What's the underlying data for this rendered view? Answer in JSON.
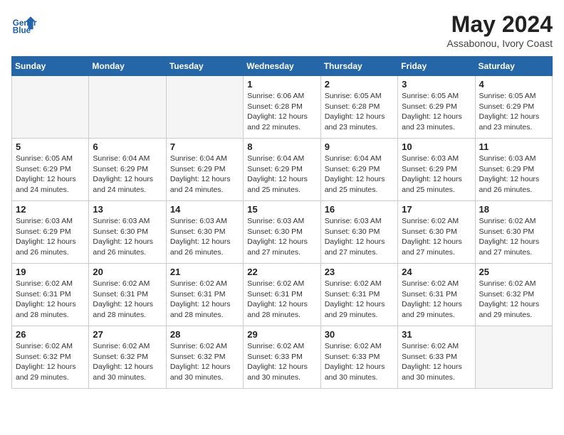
{
  "header": {
    "logo_line1": "General",
    "logo_line2": "Blue",
    "month_year": "May 2024",
    "location": "Assabonou, Ivory Coast"
  },
  "weekdays": [
    "Sunday",
    "Monday",
    "Tuesday",
    "Wednesday",
    "Thursday",
    "Friday",
    "Saturday"
  ],
  "weeks": [
    [
      {
        "day": "",
        "info": ""
      },
      {
        "day": "",
        "info": ""
      },
      {
        "day": "",
        "info": ""
      },
      {
        "day": "1",
        "info": "Sunrise: 6:06 AM\nSunset: 6:28 PM\nDaylight: 12 hours\nand 22 minutes."
      },
      {
        "day": "2",
        "info": "Sunrise: 6:05 AM\nSunset: 6:28 PM\nDaylight: 12 hours\nand 23 minutes."
      },
      {
        "day": "3",
        "info": "Sunrise: 6:05 AM\nSunset: 6:29 PM\nDaylight: 12 hours\nand 23 minutes."
      },
      {
        "day": "4",
        "info": "Sunrise: 6:05 AM\nSunset: 6:29 PM\nDaylight: 12 hours\nand 23 minutes."
      }
    ],
    [
      {
        "day": "5",
        "info": "Sunrise: 6:05 AM\nSunset: 6:29 PM\nDaylight: 12 hours\nand 24 minutes."
      },
      {
        "day": "6",
        "info": "Sunrise: 6:04 AM\nSunset: 6:29 PM\nDaylight: 12 hours\nand 24 minutes."
      },
      {
        "day": "7",
        "info": "Sunrise: 6:04 AM\nSunset: 6:29 PM\nDaylight: 12 hours\nand 24 minutes."
      },
      {
        "day": "8",
        "info": "Sunrise: 6:04 AM\nSunset: 6:29 PM\nDaylight: 12 hours\nand 25 minutes."
      },
      {
        "day": "9",
        "info": "Sunrise: 6:04 AM\nSunset: 6:29 PM\nDaylight: 12 hours\nand 25 minutes."
      },
      {
        "day": "10",
        "info": "Sunrise: 6:03 AM\nSunset: 6:29 PM\nDaylight: 12 hours\nand 25 minutes."
      },
      {
        "day": "11",
        "info": "Sunrise: 6:03 AM\nSunset: 6:29 PM\nDaylight: 12 hours\nand 26 minutes."
      }
    ],
    [
      {
        "day": "12",
        "info": "Sunrise: 6:03 AM\nSunset: 6:29 PM\nDaylight: 12 hours\nand 26 minutes."
      },
      {
        "day": "13",
        "info": "Sunrise: 6:03 AM\nSunset: 6:30 PM\nDaylight: 12 hours\nand 26 minutes."
      },
      {
        "day": "14",
        "info": "Sunrise: 6:03 AM\nSunset: 6:30 PM\nDaylight: 12 hours\nand 26 minutes."
      },
      {
        "day": "15",
        "info": "Sunrise: 6:03 AM\nSunset: 6:30 PM\nDaylight: 12 hours\nand 27 minutes."
      },
      {
        "day": "16",
        "info": "Sunrise: 6:03 AM\nSunset: 6:30 PM\nDaylight: 12 hours\nand 27 minutes."
      },
      {
        "day": "17",
        "info": "Sunrise: 6:02 AM\nSunset: 6:30 PM\nDaylight: 12 hours\nand 27 minutes."
      },
      {
        "day": "18",
        "info": "Sunrise: 6:02 AM\nSunset: 6:30 PM\nDaylight: 12 hours\nand 27 minutes."
      }
    ],
    [
      {
        "day": "19",
        "info": "Sunrise: 6:02 AM\nSunset: 6:31 PM\nDaylight: 12 hours\nand 28 minutes."
      },
      {
        "day": "20",
        "info": "Sunrise: 6:02 AM\nSunset: 6:31 PM\nDaylight: 12 hours\nand 28 minutes."
      },
      {
        "day": "21",
        "info": "Sunrise: 6:02 AM\nSunset: 6:31 PM\nDaylight: 12 hours\nand 28 minutes."
      },
      {
        "day": "22",
        "info": "Sunrise: 6:02 AM\nSunset: 6:31 PM\nDaylight: 12 hours\nand 28 minutes."
      },
      {
        "day": "23",
        "info": "Sunrise: 6:02 AM\nSunset: 6:31 PM\nDaylight: 12 hours\nand 29 minutes."
      },
      {
        "day": "24",
        "info": "Sunrise: 6:02 AM\nSunset: 6:31 PM\nDaylight: 12 hours\nand 29 minutes."
      },
      {
        "day": "25",
        "info": "Sunrise: 6:02 AM\nSunset: 6:32 PM\nDaylight: 12 hours\nand 29 minutes."
      }
    ],
    [
      {
        "day": "26",
        "info": "Sunrise: 6:02 AM\nSunset: 6:32 PM\nDaylight: 12 hours\nand 29 minutes."
      },
      {
        "day": "27",
        "info": "Sunrise: 6:02 AM\nSunset: 6:32 PM\nDaylight: 12 hours\nand 30 minutes."
      },
      {
        "day": "28",
        "info": "Sunrise: 6:02 AM\nSunset: 6:32 PM\nDaylight: 12 hours\nand 30 minutes."
      },
      {
        "day": "29",
        "info": "Sunrise: 6:02 AM\nSunset: 6:33 PM\nDaylight: 12 hours\nand 30 minutes."
      },
      {
        "day": "30",
        "info": "Sunrise: 6:02 AM\nSunset: 6:33 PM\nDaylight: 12 hours\nand 30 minutes."
      },
      {
        "day": "31",
        "info": "Sunrise: 6:02 AM\nSunset: 6:33 PM\nDaylight: 12 hours\nand 30 minutes."
      },
      {
        "day": "",
        "info": ""
      }
    ]
  ]
}
